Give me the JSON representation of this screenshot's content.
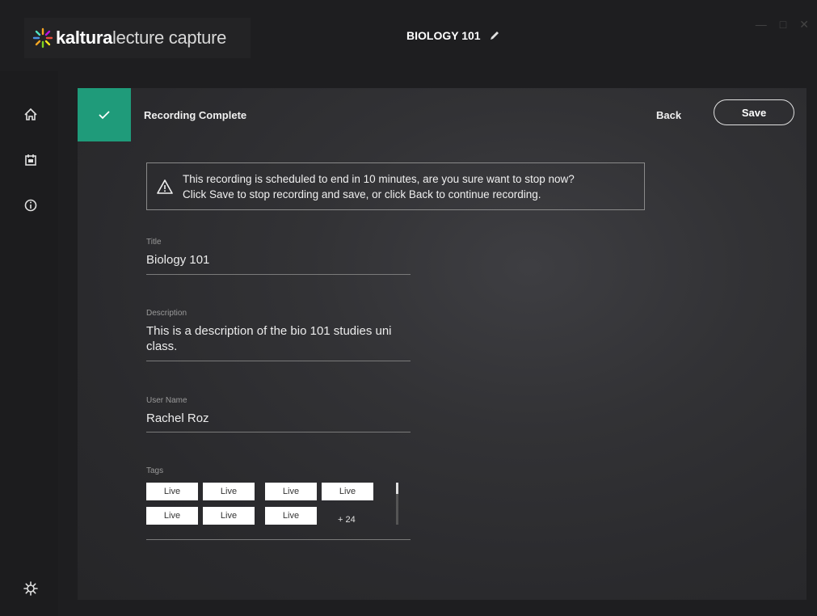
{
  "app": {
    "logo_bold": "kaltura",
    "logo_light": "lecture capture",
    "course_title": "BIOLOGY 101"
  },
  "header": {
    "status": "Recording Complete",
    "back_label": "Back",
    "save_label": "Save"
  },
  "warning": {
    "line1": "This recording is scheduled to end in 10 minutes, are you sure want to stop now?",
    "line2": "Click Save to stop recording and save, or click Back to continue recording."
  },
  "form": {
    "title": {
      "label": "Title",
      "value": "Biology 101"
    },
    "description": {
      "label": "Description",
      "value": "This is a description of the bio 101 studies uni class."
    },
    "user_name": {
      "label": "User Name",
      "value": "Rachel Roz"
    },
    "tags": {
      "label": "Tags",
      "items": [
        "Live",
        "Live",
        "Live",
        "Live",
        "Live",
        "Live",
        "Live"
      ],
      "more": "+ 24"
    }
  },
  "colors": {
    "accent": "#1f9b7a",
    "panel": "#323235",
    "background": "#1e1e20"
  },
  "icons": {
    "sidebar": [
      "home-icon",
      "calendar-icon",
      "info-icon",
      "settings-icon"
    ]
  }
}
